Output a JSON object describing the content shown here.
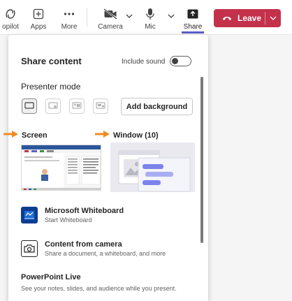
{
  "toolbar": {
    "copilot_label": "opilot",
    "apps_label": "Apps",
    "more_label": "More",
    "camera_label": "Camera",
    "mic_label": "Mic",
    "share_label": "Share",
    "leave_label": "Leave"
  },
  "colors": {
    "leave": "#c4314b",
    "accent": "#5b5fc7",
    "arrow": "#f08a24"
  },
  "panel": {
    "title": "Share content",
    "include_sound_label": "Include sound",
    "include_sound_on": false,
    "presenter_mode_label": "Presenter mode",
    "presenter_modes": [
      "content-only",
      "standout",
      "side-by-side",
      "reporter"
    ],
    "presenter_mode_selected": "content-only",
    "add_background_label": "Add background",
    "screen_label": "Screen",
    "window_label": "Window (10)",
    "items": [
      {
        "title": "Microsoft Whiteboard",
        "subtitle": "Start Whiteboard",
        "icon": "whiteboard-icon"
      },
      {
        "title": "Content from camera",
        "subtitle": "Share a document, a whiteboard, and more",
        "icon": "camera-content-icon"
      }
    ],
    "powerpoint_title": "PowerPoint Live",
    "powerpoint_subtitle": "See your notes, slides, and audience while you present."
  }
}
